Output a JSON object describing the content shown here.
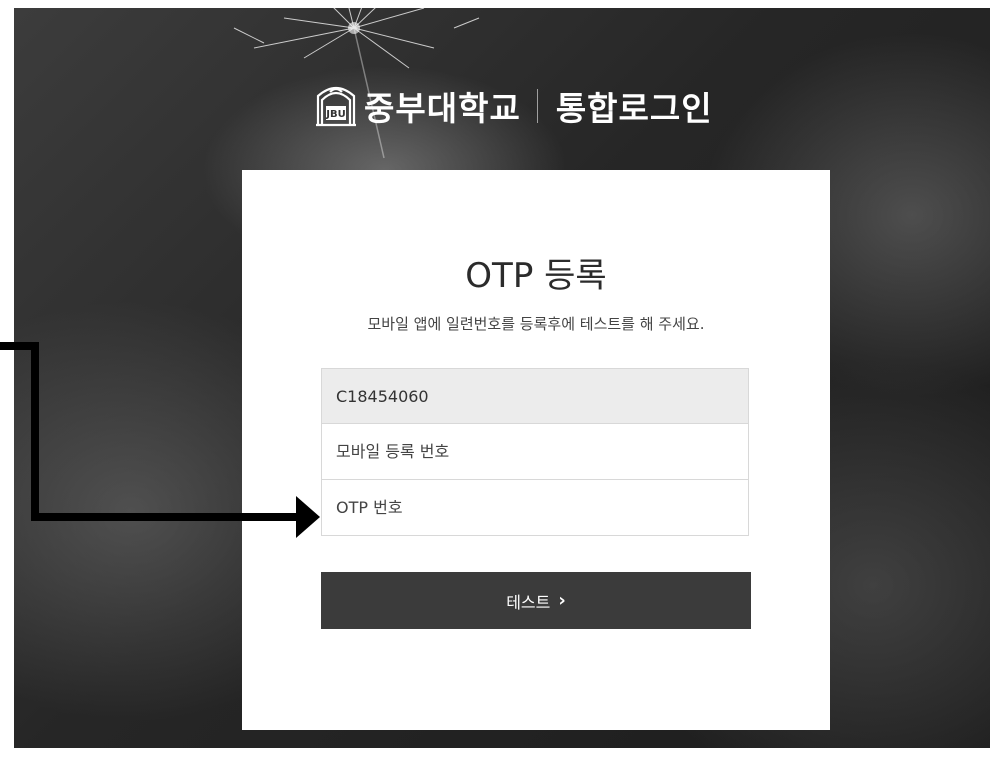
{
  "header": {
    "university_name": "중부대학교",
    "service_name": "통합로그인",
    "emblem_text": "JBU"
  },
  "card": {
    "title": "OTP 등록",
    "description": "모바일 앱에 일련번호를 등록후에 테스트를 해 주세요.",
    "serial_value": "C18454060",
    "mobile_placeholder": "모바일 등록 번호",
    "otp_placeholder": "OTP 번호",
    "test_button_label": "테스트",
    "test_button_chevron": "›"
  },
  "icons": {
    "logo": "university-emblem-icon",
    "chevron": "chevron-right-icon",
    "annotation": "arrow-right-icon"
  },
  "colors": {
    "card_bg": "#ffffff",
    "button_bg": "#3b3b3b",
    "readonly_field_bg": "#ececec",
    "annotation": "#000000"
  }
}
